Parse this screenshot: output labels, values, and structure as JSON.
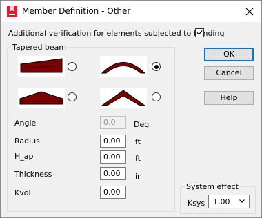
{
  "window": {
    "title": "Member Definition - Other",
    "close_glyph": "✕"
  },
  "verification": {
    "label": "Additional verification for elements subjected to bending",
    "checked": true,
    "check_glyph": "✓"
  },
  "tapered_beam": {
    "group_title": "Tapered beam",
    "shape_color": "#7b0000",
    "options": [
      {
        "icon": "single-taper-beam-icon",
        "selected": false
      },
      {
        "icon": "curved-beam-icon",
        "selected": true
      },
      {
        "icon": "double-taper-beam-icon",
        "selected": false
      },
      {
        "icon": "pitched-beam-icon",
        "selected": false
      }
    ],
    "fields": [
      {
        "label": "Angle",
        "value": "0.0",
        "unit": "Deg",
        "enabled": false
      },
      {
        "label": "Radius",
        "value": "0.00",
        "unit": "ft",
        "enabled": true
      },
      {
        "label": "H_ap",
        "value": "0.00",
        "unit": "ft",
        "enabled": true
      },
      {
        "label": "Thickness",
        "value": "0.00",
        "unit": "in",
        "enabled": true
      },
      {
        "label": "Kvol",
        "value": "0.00",
        "unit": "",
        "enabled": true
      }
    ]
  },
  "buttons": {
    "ok": "OK",
    "cancel": "Cancel",
    "help": "Help"
  },
  "system_effect": {
    "group_title": "System effect",
    "ksys_label": "Ksys",
    "ksys_value": "1,00",
    "arrow_glyph": "⌄"
  }
}
